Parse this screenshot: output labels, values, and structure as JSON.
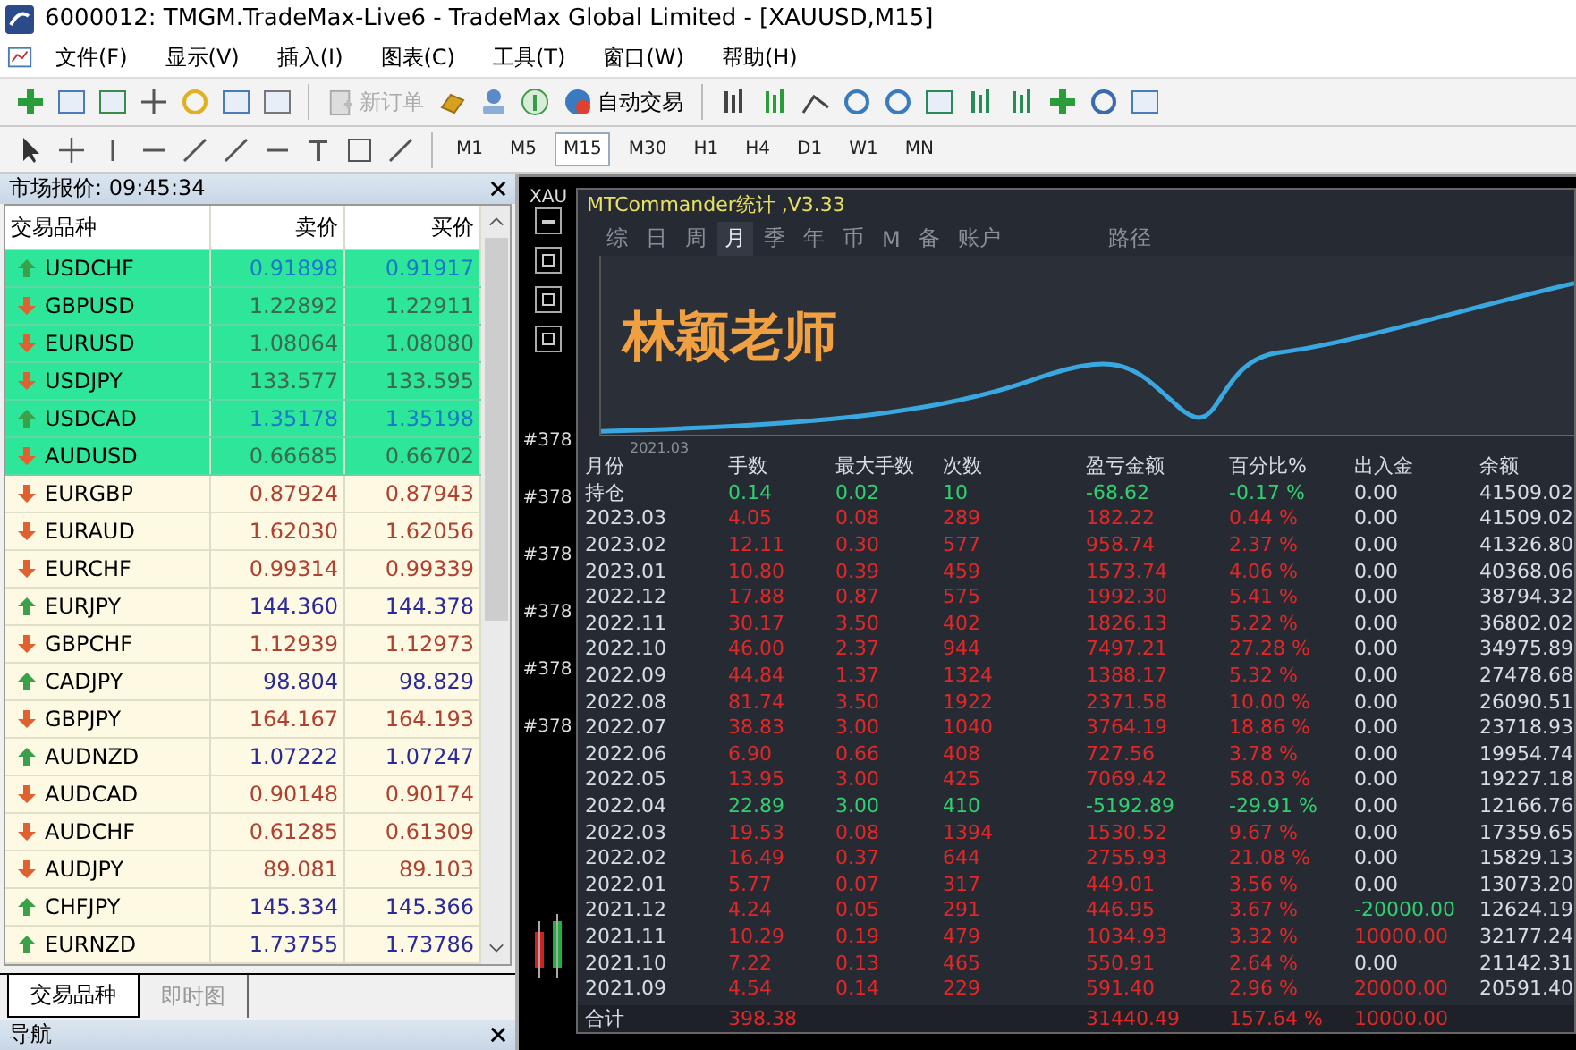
{
  "window": {
    "title": "6000012: TMGM.TradeMax-Live6 - TradeMax Global Limited - [XAUUSD,M15]"
  },
  "menu": [
    "文件(F)",
    "显示(V)",
    "插入(I)",
    "图表(C)",
    "工具(T)",
    "窗口(W)",
    "帮助(H)"
  ],
  "toolbar": {
    "new_order": {
      "label": "新订单",
      "disabled": true
    },
    "auto_trading": {
      "label": "自动交易"
    }
  },
  "timeframes": [
    {
      "label": "M1",
      "selected": false
    },
    {
      "label": "M5",
      "selected": false
    },
    {
      "label": "M15",
      "selected": true
    },
    {
      "label": "M30",
      "selected": false
    },
    {
      "label": "H1",
      "selected": false
    },
    {
      "label": "H4",
      "selected": false
    },
    {
      "label": "D1",
      "selected": false
    },
    {
      "label": "W1",
      "selected": false
    },
    {
      "label": "MN",
      "selected": false
    }
  ],
  "market_watch": {
    "title": "市场报价: 09:45:34",
    "columns": [
      "交易品种",
      "卖价",
      "买价"
    ],
    "rows": [
      {
        "symbol": "USDCHF",
        "bid": "0.91898",
        "ask": "0.91917",
        "rising": true,
        "highlighted": true
      },
      {
        "symbol": "GBPUSD",
        "bid": "1.22892",
        "ask": "1.22911",
        "rising": false,
        "highlighted": true
      },
      {
        "symbol": "EURUSD",
        "bid": "1.08064",
        "ask": "1.08080",
        "rising": false,
        "highlighted": true
      },
      {
        "symbol": "USDJPY",
        "bid": "133.577",
        "ask": "133.595",
        "rising": false,
        "highlighted": true
      },
      {
        "symbol": "USDCAD",
        "bid": "1.35178",
        "ask": "1.35198",
        "rising": true,
        "highlighted": true
      },
      {
        "symbol": "AUDUSD",
        "bid": "0.66685",
        "ask": "0.66702",
        "rising": false,
        "highlighted": true
      },
      {
        "symbol": "EURGBP",
        "bid": "0.87924",
        "ask": "0.87943",
        "rising": false,
        "highlighted": false
      },
      {
        "symbol": "EURAUD",
        "bid": "1.62030",
        "ask": "1.62056",
        "rising": false,
        "highlighted": false
      },
      {
        "symbol": "EURCHF",
        "bid": "0.99314",
        "ask": "0.99339",
        "rising": false,
        "highlighted": false
      },
      {
        "symbol": "EURJPY",
        "bid": "144.360",
        "ask": "144.378",
        "rising": true,
        "highlighted": false
      },
      {
        "symbol": "GBPCHF",
        "bid": "1.12939",
        "ask": "1.12973",
        "rising": false,
        "highlighted": false
      },
      {
        "symbol": "CADJPY",
        "bid": "98.804",
        "ask": "98.829",
        "rising": true,
        "highlighted": false
      },
      {
        "symbol": "GBPJPY",
        "bid": "164.167",
        "ask": "164.193",
        "rising": false,
        "highlighted": false
      },
      {
        "symbol": "AUDNZD",
        "bid": "1.07222",
        "ask": "1.07247",
        "rising": true,
        "highlighted": false
      },
      {
        "symbol": "AUDCAD",
        "bid": "0.90148",
        "ask": "0.90174",
        "rising": false,
        "highlighted": false
      },
      {
        "symbol": "AUDCHF",
        "bid": "0.61285",
        "ask": "0.61309",
        "rising": false,
        "highlighted": false
      },
      {
        "symbol": "AUDJPY",
        "bid": "89.081",
        "ask": "89.103",
        "rising": false,
        "highlighted": false
      },
      {
        "symbol": "CHFJPY",
        "bid": "145.334",
        "ask": "145.366",
        "rising": true,
        "highlighted": false
      },
      {
        "symbol": "EURNZD",
        "bid": "1.73755",
        "ask": "1.73786",
        "rising": true,
        "highlighted": false
      }
    ],
    "tabs": [
      {
        "label": "交易品种",
        "selected": true
      },
      {
        "label": "即时图",
        "selected": false
      }
    ]
  },
  "navigator": {
    "title": "导航"
  },
  "chart": {
    "symbol": "XAU",
    "object_labels": [
      "#378",
      "#378",
      "#378",
      "#378",
      "#378",
      "#378"
    ]
  },
  "stats_window": {
    "title": "MTCommander统计 ,V3.33",
    "tabs": [
      {
        "label": "综",
        "selected": false
      },
      {
        "label": "日",
        "selected": false
      },
      {
        "label": "周",
        "selected": false
      },
      {
        "label": "月",
        "selected": true
      },
      {
        "label": "季",
        "selected": false
      },
      {
        "label": "年",
        "selected": false
      },
      {
        "label": "币",
        "selected": false
      },
      {
        "label": "M",
        "selected": false
      },
      {
        "label": "备",
        "selected": false
      },
      {
        "label": "账户",
        "selected": false
      },
      {
        "label": "路径",
        "selected": false
      }
    ],
    "overlay_title": "林颖老师",
    "start_label": "2021.03",
    "columns": [
      "月份",
      "手数",
      "最大手数",
      "次数",
      "盈亏金额",
      "百分比%",
      "出入金",
      "余额"
    ],
    "rows": [
      {
        "month": "持仓",
        "lots": "0.14",
        "max_lots": "0.02",
        "trades": "10",
        "pnl": "-68.62",
        "percent": "-0.17 %",
        "flow": "0.00",
        "balance": "41509.02",
        "loss": true,
        "flow_in": false,
        "flow_out": false
      },
      {
        "month": "2023.03",
        "lots": "4.05",
        "max_lots": "0.08",
        "trades": "289",
        "pnl": "182.22",
        "percent": "0.44 %",
        "flow": "0.00",
        "balance": "41509.02",
        "loss": false,
        "flow_in": false,
        "flow_out": false
      },
      {
        "month": "2023.02",
        "lots": "12.11",
        "max_lots": "0.30",
        "trades": "577",
        "pnl": "958.74",
        "percent": "2.37 %",
        "flow": "0.00",
        "balance": "41326.80",
        "loss": false,
        "flow_in": false,
        "flow_out": false
      },
      {
        "month": "2023.01",
        "lots": "10.80",
        "max_lots": "0.39",
        "trades": "459",
        "pnl": "1573.74",
        "percent": "4.06 %",
        "flow": "0.00",
        "balance": "40368.06",
        "loss": false,
        "flow_in": false,
        "flow_out": false
      },
      {
        "month": "2022.12",
        "lots": "17.88",
        "max_lots": "0.87",
        "trades": "575",
        "pnl": "1992.30",
        "percent": "5.41 %",
        "flow": "0.00",
        "balance": "38794.32",
        "loss": false,
        "flow_in": false,
        "flow_out": false
      },
      {
        "month": "2022.11",
        "lots": "30.17",
        "max_lots": "3.50",
        "trades": "402",
        "pnl": "1826.13",
        "percent": "5.22 %",
        "flow": "0.00",
        "balance": "36802.02",
        "loss": false,
        "flow_in": false,
        "flow_out": false
      },
      {
        "month": "2022.10",
        "lots": "46.00",
        "max_lots": "2.37",
        "trades": "944",
        "pnl": "7497.21",
        "percent": "27.28 %",
        "flow": "0.00",
        "balance": "34975.89",
        "loss": false,
        "flow_in": false,
        "flow_out": false
      },
      {
        "month": "2022.09",
        "lots": "44.84",
        "max_lots": "1.37",
        "trades": "1324",
        "pnl": "1388.17",
        "percent": "5.32 %",
        "flow": "0.00",
        "balance": "27478.68",
        "loss": false,
        "flow_in": false,
        "flow_out": false
      },
      {
        "month": "2022.08",
        "lots": "81.74",
        "max_lots": "3.50",
        "trades": "1922",
        "pnl": "2371.58",
        "percent": "10.00 %",
        "flow": "0.00",
        "balance": "26090.51",
        "loss": false,
        "flow_in": false,
        "flow_out": false
      },
      {
        "month": "2022.07",
        "lots": "38.83",
        "max_lots": "3.00",
        "trades": "1040",
        "pnl": "3764.19",
        "percent": "18.86 %",
        "flow": "0.00",
        "balance": "23718.93",
        "loss": false,
        "flow_in": false,
        "flow_out": false
      },
      {
        "month": "2022.06",
        "lots": "6.90",
        "max_lots": "0.66",
        "trades": "408",
        "pnl": "727.56",
        "percent": "3.78 %",
        "flow": "0.00",
        "balance": "19954.74",
        "loss": false,
        "flow_in": false,
        "flow_out": false
      },
      {
        "month": "2022.05",
        "lots": "13.95",
        "max_lots": "3.00",
        "trades": "425",
        "pnl": "7069.42",
        "percent": "58.03 %",
        "flow": "0.00",
        "balance": "19227.18",
        "loss": false,
        "flow_in": false,
        "flow_out": false
      },
      {
        "month": "2022.04",
        "lots": "22.89",
        "max_lots": "3.00",
        "trades": "410",
        "pnl": "-5192.89",
        "percent": "-29.91 %",
        "flow": "0.00",
        "balance": "12166.76",
        "loss": true,
        "flow_in": false,
        "flow_out": false
      },
      {
        "month": "2022.03",
        "lots": "19.53",
        "max_lots": "0.08",
        "trades": "1394",
        "pnl": "1530.52",
        "percent": "9.67 %",
        "flow": "0.00",
        "balance": "17359.65",
        "loss": false,
        "flow_in": false,
        "flow_out": false
      },
      {
        "month": "2022.02",
        "lots": "16.49",
        "max_lots": "0.37",
        "trades": "644",
        "pnl": "2755.93",
        "percent": "21.08 %",
        "flow": "0.00",
        "balance": "15829.13",
        "loss": false,
        "flow_in": false,
        "flow_out": false
      },
      {
        "month": "2022.01",
        "lots": "5.77",
        "max_lots": "0.07",
        "trades": "317",
        "pnl": "449.01",
        "percent": "3.56 %",
        "flow": "0.00",
        "balance": "13073.20",
        "loss": false,
        "flow_in": false,
        "flow_out": false
      },
      {
        "month": "2021.12",
        "lots": "4.24",
        "max_lots": "0.05",
        "trades": "291",
        "pnl": "446.95",
        "percent": "3.67 %",
        "flow": "-20000.00",
        "balance": "12624.19",
        "loss": false,
        "flow_in": false,
        "flow_out": true
      },
      {
        "month": "2021.11",
        "lots": "10.29",
        "max_lots": "0.19",
        "trades": "479",
        "pnl": "1034.93",
        "percent": "3.32 %",
        "flow": "10000.00",
        "balance": "32177.24",
        "loss": false,
        "flow_in": true,
        "flow_out": false
      },
      {
        "month": "2021.10",
        "lots": "7.22",
        "max_lots": "0.13",
        "trades": "465",
        "pnl": "550.91",
        "percent": "2.64 %",
        "flow": "0.00",
        "balance": "21142.31",
        "loss": false,
        "flow_in": false,
        "flow_out": false
      },
      {
        "month": "2021.09",
        "lots": "4.54",
        "max_lots": "0.14",
        "trades": "229",
        "pnl": "591.40",
        "percent": "2.96 %",
        "flow": "20000.00",
        "balance": "20591.40",
        "loss": false,
        "flow_in": true,
        "flow_out": false
      }
    ],
    "total": {
      "month": "合计",
      "lots": "398.38",
      "pnl": "31440.49",
      "percent": "157.64 %",
      "flow": "10000.00"
    }
  }
}
